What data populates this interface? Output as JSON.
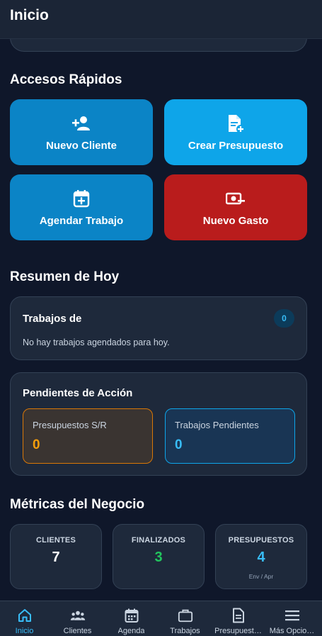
{
  "header": {
    "title": "Inicio"
  },
  "quick_access": {
    "title": "Accesos Rápidos",
    "buttons": [
      {
        "label": "Nuevo Cliente",
        "icon": "add-user-icon",
        "color": "#0b84c6"
      },
      {
        "label": "Crear Presupuesto",
        "icon": "document-add-icon",
        "color": "#0ea5e9"
      },
      {
        "label": "Agendar Trabajo",
        "icon": "calendar-add-icon",
        "color": "#0b84c6"
      },
      {
        "label": "Nuevo Gasto",
        "icon": "money-remove-icon",
        "color": "#b91c1c"
      }
    ]
  },
  "summary": {
    "title": "Resumen de Hoy",
    "jobs_card": {
      "title": "Trabajos de",
      "count": "0",
      "empty_text": "No hay trabajos agendados para hoy."
    },
    "pending_card": {
      "title": "Pendientes de Acción",
      "items": [
        {
          "label": "Presupuestos S/R",
          "value": "0",
          "color": "#f59e0b"
        },
        {
          "label": "Trabajos Pendientes",
          "value": "0",
          "color": "#38bdf8"
        }
      ]
    }
  },
  "metrics": {
    "title": "Métricas del Negocio",
    "items": [
      {
        "label": "CLIENTES",
        "value": "7",
        "color": "#ffffff",
        "sub": ""
      },
      {
        "label": "FINALIZADOS",
        "value": "3",
        "color": "#22c55e",
        "sub": ""
      },
      {
        "label": "PRESUPUESTOS",
        "value": "4",
        "color": "#38bdf8",
        "sub": "Env / Apr"
      }
    ]
  },
  "bottom_nav": {
    "active": "Inicio",
    "items": [
      {
        "label": "Inicio",
        "icon": "home-icon"
      },
      {
        "label": "Clientes",
        "icon": "users-icon"
      },
      {
        "label": "Agenda",
        "icon": "calendar-icon"
      },
      {
        "label": "Trabajos",
        "icon": "briefcase-icon"
      },
      {
        "label": "Presupuest…",
        "icon": "document-icon"
      },
      {
        "label": "Más Opcio…",
        "icon": "menu-icon"
      }
    ]
  }
}
